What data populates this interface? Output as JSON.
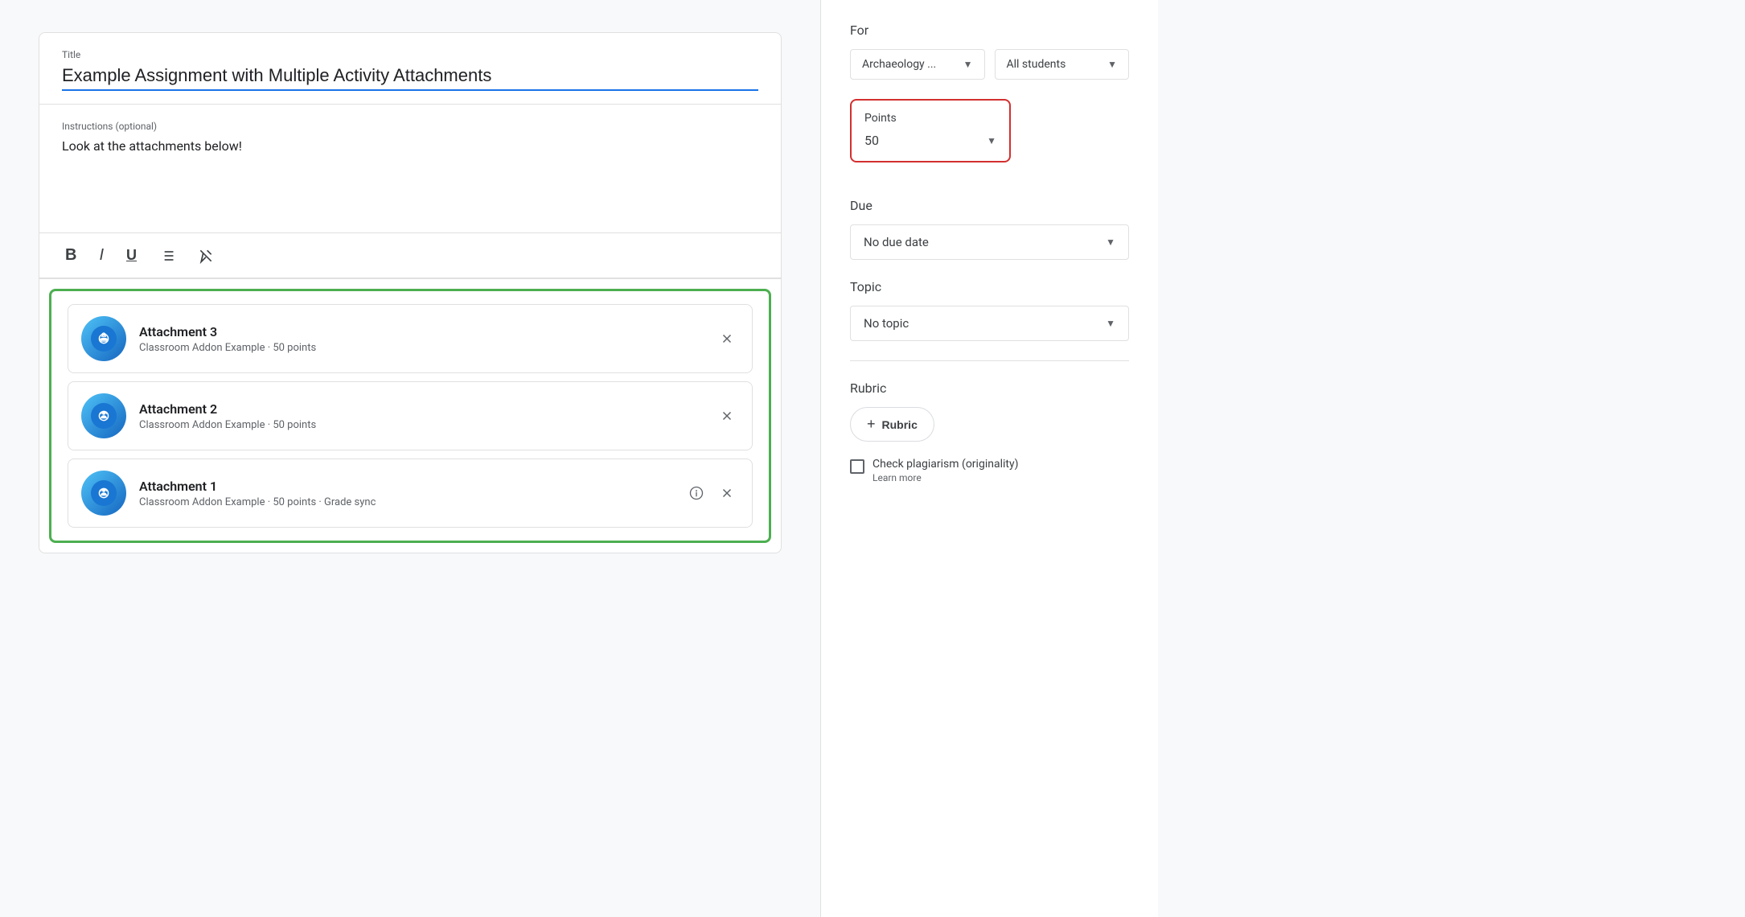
{
  "main": {
    "title_label": "Title",
    "title_value": "Example Assignment with Multiple Activity Attachments",
    "instructions_label": "Instructions (optional)",
    "instructions_value": "Look at the attachments below!",
    "toolbar": {
      "bold": "B",
      "italic": "I",
      "underline": "U"
    },
    "attachments": [
      {
        "name": "Attachment 3",
        "meta": "Classroom Addon Example · 50 points",
        "has_info": false
      },
      {
        "name": "Attachment 2",
        "meta": "Classroom Addon Example · 50 points",
        "has_info": false
      },
      {
        "name": "Attachment 1",
        "meta": "Classroom Addon Example · 50 points · Grade sync",
        "has_info": true
      }
    ]
  },
  "sidebar": {
    "for_label": "For",
    "class_value": "Archaeology ...",
    "students_value": "All students",
    "points_label": "Points",
    "points_value": "50",
    "due_label": "Due",
    "due_value": "No due date",
    "topic_label": "Topic",
    "topic_value": "No topic",
    "rubric_label": "Rubric",
    "rubric_btn_label": "Rubric",
    "plagiarism_label": "Check plagiarism (originality)",
    "learn_more": "Learn more"
  }
}
